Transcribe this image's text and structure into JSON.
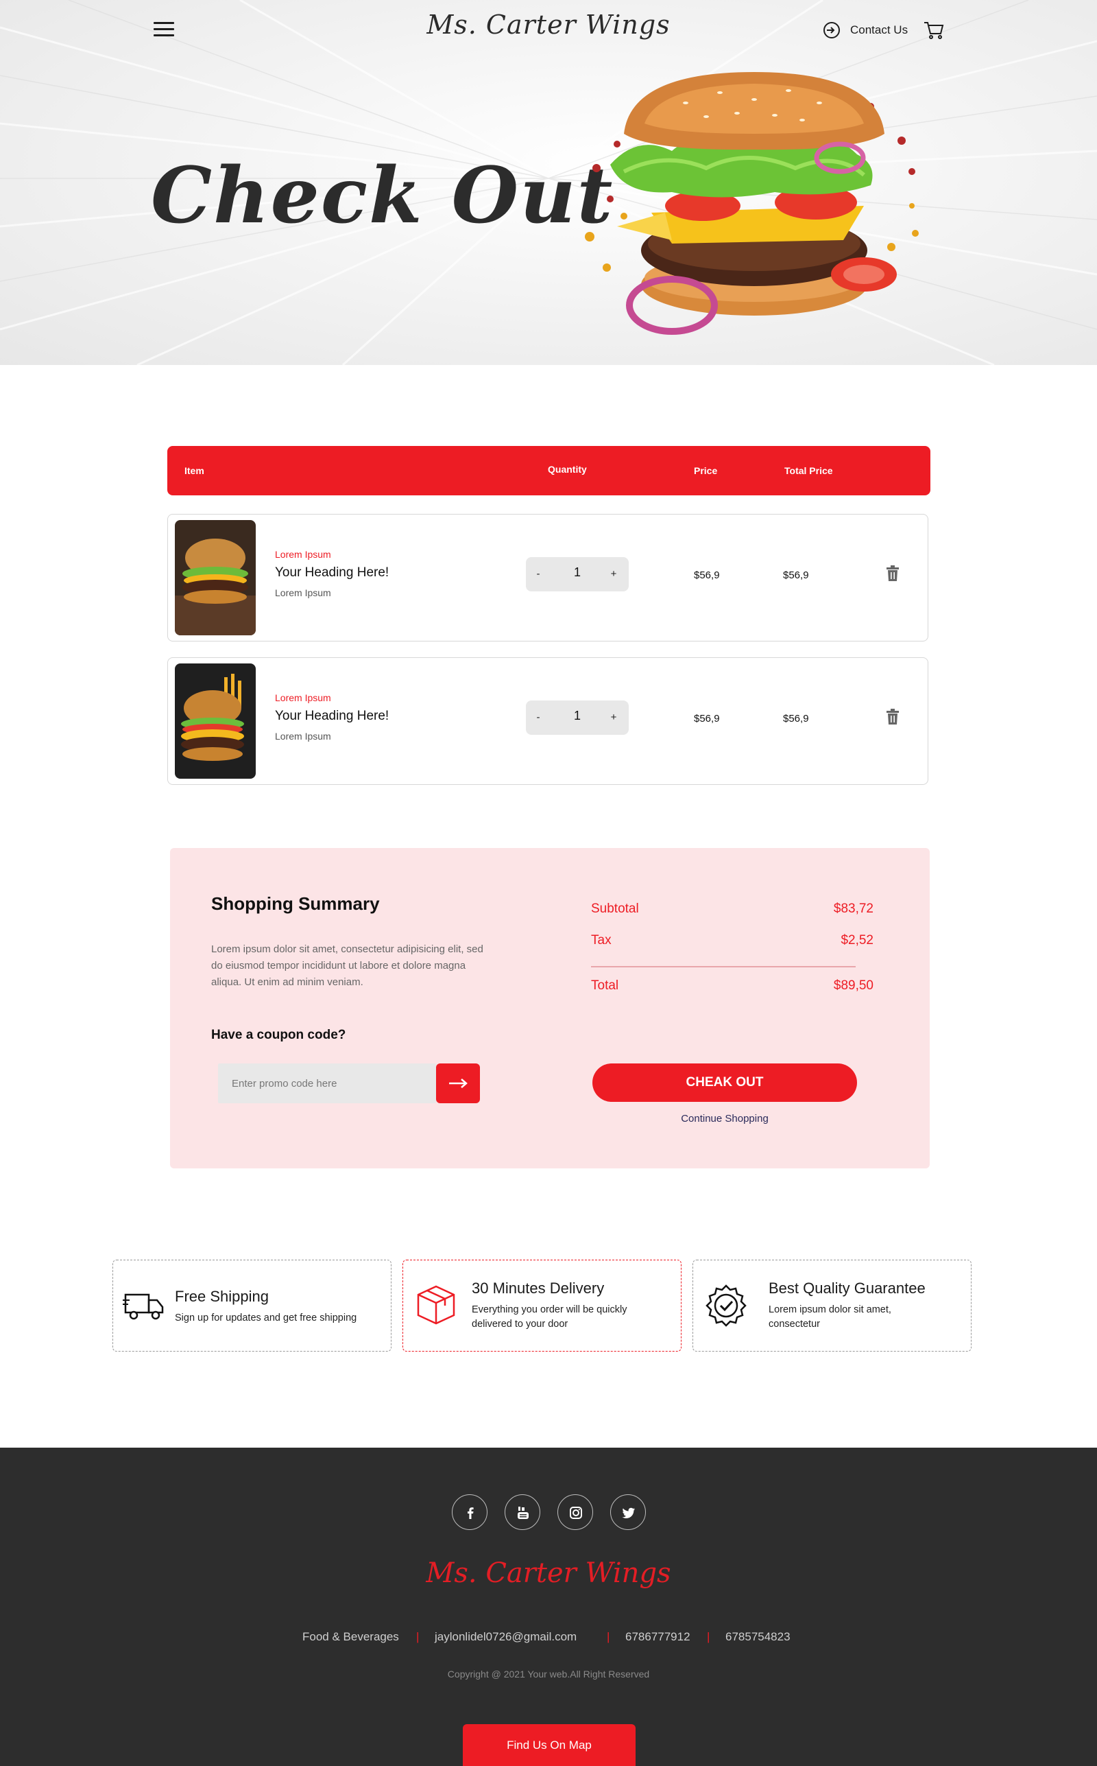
{
  "header": {
    "brand": "Ms. Carter Wings",
    "contact_label": "Contact Us",
    "menu_icon": "hamburger-menu-icon",
    "contact_icon": "sign-in-icon",
    "cart_icon": "shopping-cart-icon"
  },
  "hero": {
    "title": "Check Out"
  },
  "cart_table": {
    "columns": [
      "Item",
      "Quantity",
      "Price",
      "Total Price"
    ],
    "rows": [
      {
        "category": "Lorem Ipsum",
        "title": "Your Heading Here!",
        "subtitle": "Lorem Ipsum",
        "quantity": "1",
        "minus": "-",
        "plus": "+",
        "price": "$56,9",
        "total": "$56,9"
      },
      {
        "category": "Lorem Ipsum",
        "title": "Your Heading Here!",
        "subtitle": "Lorem Ipsum",
        "quantity": "1",
        "minus": "-",
        "plus": "+",
        "price": "$56,9",
        "total": "$56,9"
      }
    ]
  },
  "summary": {
    "title": "Shopping Summary",
    "text": "Lorem ipsum dolor sit amet, consectetur adipisicing elit, sed do eiusmod tempor incididunt ut labore et dolore magna aliqua. Ut enim ad minim veniam.",
    "coupon_label": "Have a coupon code?",
    "promo_placeholder": "Enter promo code here",
    "subtotal_label": "Subtotal",
    "subtotal_value": "$83,72",
    "tax_label": "Tax",
    "tax_value": "$2,52",
    "total_label": "Total",
    "total_value": "$89,50",
    "checkout_label": "CHEAK OUT",
    "continue_label": "Continue Shopping"
  },
  "features": [
    {
      "icon": "delivery-truck-icon",
      "title": "Free Shipping",
      "text": "Sign up for updates and get free shipping"
    },
    {
      "icon": "package-box-icon",
      "title": "30 Minutes Delivery",
      "text": "Everything you order will be quickly delivered to your door"
    },
    {
      "icon": "quality-badge-icon",
      "title": "Best Quality Guarantee",
      "text": "Lorem ipsum dolor sit amet, consectetur"
    }
  ],
  "footer": {
    "social": [
      "facebook-icon",
      "youtube-icon",
      "instagram-icon",
      "twitter-icon"
    ],
    "brand": "Ms. Carter Wings",
    "info": [
      "Food & Beverages",
      "jaylonlidel0726@gmail.com",
      "6786777912",
      "6785754823"
    ],
    "separator": "|",
    "copyright": "Copyright @ 2021 Your web.All Right Reserved",
    "map_button": "Find Us On Map"
  },
  "colors": {
    "accent": "#ed1c24",
    "summary_bg": "#fce4e6",
    "footer_bg": "#2d2d2d"
  }
}
